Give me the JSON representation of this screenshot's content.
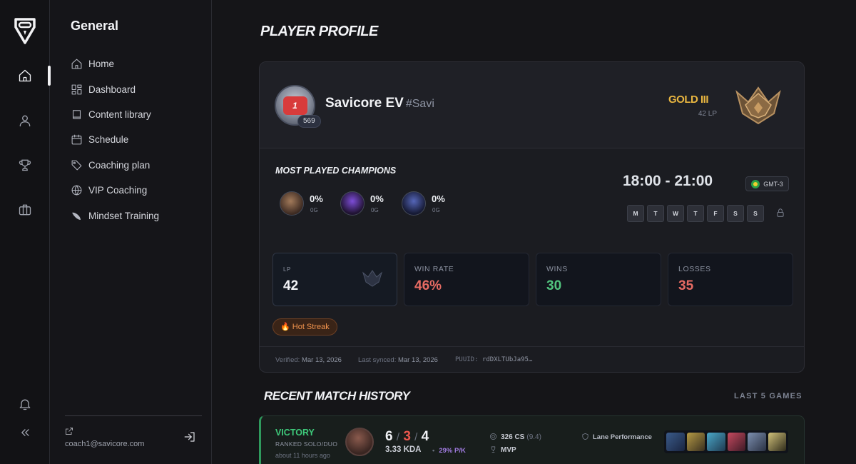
{
  "nav": {
    "section_title": "General",
    "items": [
      {
        "label": "Home",
        "icon": "home-icon"
      },
      {
        "label": "Dashboard",
        "icon": "grid-icon"
      },
      {
        "label": "Content library",
        "icon": "book-icon"
      },
      {
        "label": "Schedule",
        "icon": "calendar-icon"
      },
      {
        "label": "Coaching plan",
        "icon": "tag-icon"
      },
      {
        "label": "VIP Coaching",
        "icon": "globe-icon"
      },
      {
        "label": "Mindset Training",
        "icon": "feather-icon"
      }
    ],
    "user_email": "coach1@savicore.com"
  },
  "page": {
    "title": "PLAYER PROFILE"
  },
  "profile": {
    "name": "Savicore EV",
    "tag": "#Savi",
    "level": "569",
    "avatar_emblem": "1",
    "rank": "GOLD III",
    "lp_label": "42 LP",
    "colors": {
      "rank": "#e9b640",
      "accent_red": "#e66b63",
      "accent_green": "#52c47e"
    }
  },
  "champions": {
    "title": "MOST PLAYED CHAMPIONS",
    "list": [
      {
        "pct": "0%",
        "games": "0G"
      },
      {
        "pct": "0%",
        "games": "0G"
      },
      {
        "pct": "0%",
        "games": "0G"
      }
    ]
  },
  "schedule": {
    "time_range": "18:00 - 21:00",
    "timezone": "GMT-3",
    "days": [
      "M",
      "T",
      "W",
      "T",
      "F",
      "S",
      "S"
    ]
  },
  "stats": [
    {
      "label": "LP",
      "value": "42"
    },
    {
      "label": "WIN RATE",
      "value": "46%"
    },
    {
      "label": "WINS",
      "value": "30"
    },
    {
      "label": "LOSSES",
      "value": "35"
    }
  ],
  "badge": {
    "hot_streak": "🔥 Hot Streak"
  },
  "footer": {
    "verified_label": "Verified:",
    "verified_date": "Mar 13, 2026",
    "synced_label": "Last synced:",
    "synced_date": "Mar 13, 2026",
    "puuid_label": "PUUID:",
    "puuid": "rdDXLTUbJa95…"
  },
  "matches": {
    "title": "RECENT MATCH HISTORY",
    "subtitle": "LAST 5 GAMES",
    "list": [
      {
        "result": "VICTORY",
        "queue": "RANKED SOLO/DUO",
        "ago": "about 11 hours ago",
        "kills": "6",
        "deaths": "3",
        "assists": "4",
        "kda": "3.33 KDA",
        "kp": "29% P/K",
        "cs": "326 CS",
        "cs_per_min": "(9.4)",
        "mvp": "MVP",
        "lane_label": "Lane Performance"
      }
    ]
  }
}
